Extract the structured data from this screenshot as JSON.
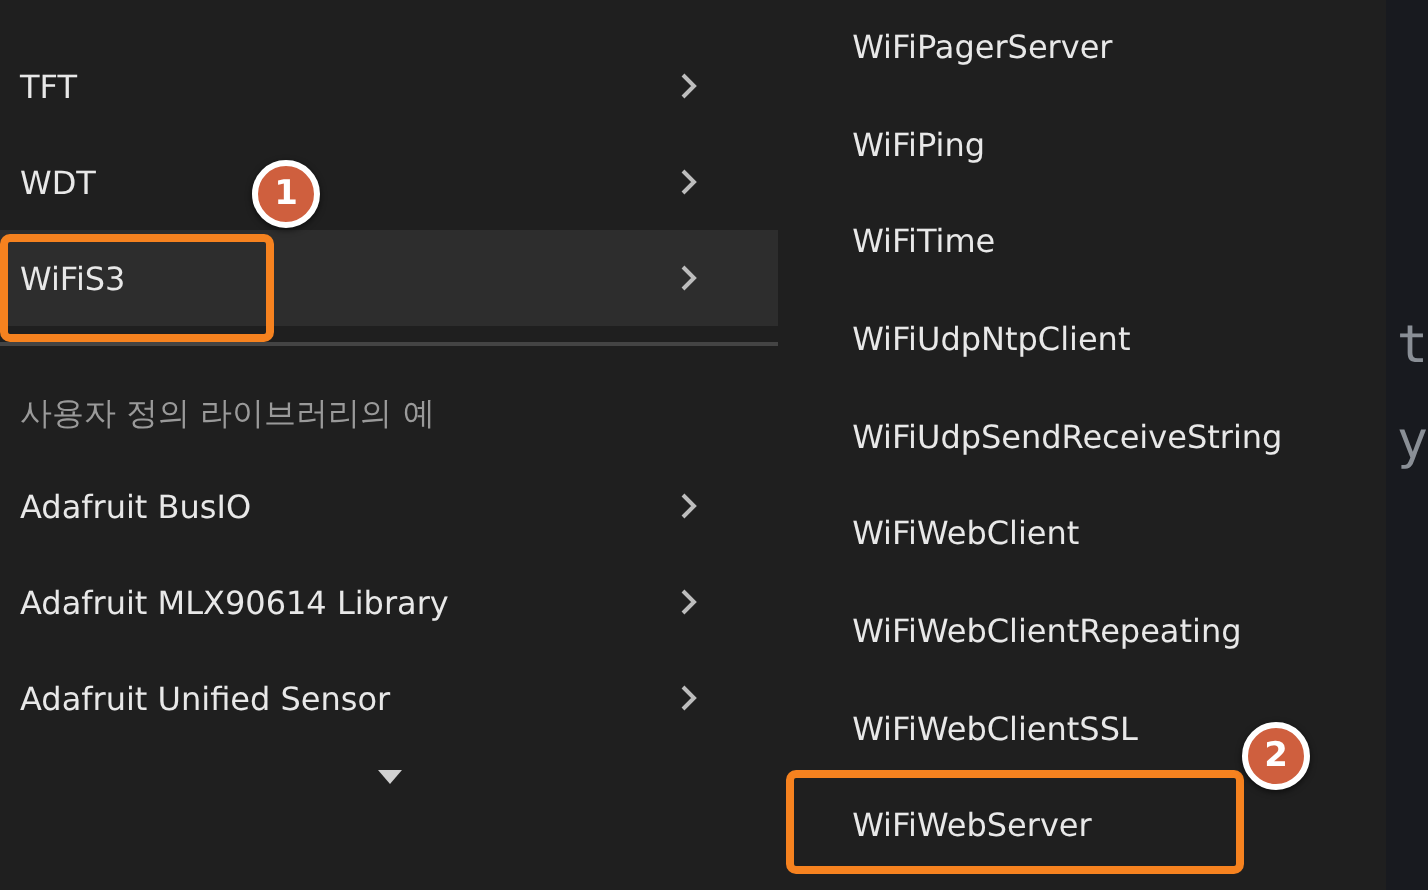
{
  "menu": {
    "items": [
      {
        "label": "TFT",
        "selected": false
      },
      {
        "label": "WDT",
        "selected": false
      },
      {
        "label": "WiFiS3",
        "selected": true
      }
    ],
    "section_header": "사용자 정의 라이브러리의 예",
    "section_items": [
      {
        "label": "Adafruit BusIO",
        "selected": false
      },
      {
        "label": "Adafruit MLX90614 Library",
        "selected": false
      },
      {
        "label": "Adafruit Unified Sensor",
        "selected": false
      }
    ]
  },
  "submenu": {
    "items": [
      {
        "label": "WiFiPagerServer",
        "selected": false
      },
      {
        "label": "WiFiPing",
        "selected": false
      },
      {
        "label": "WiFiTime",
        "selected": false
      },
      {
        "label": "WiFiUdpNtpClient",
        "selected": false
      },
      {
        "label": "WiFiUdpSendReceiveString",
        "selected": false
      },
      {
        "label": "WiFiWebClient",
        "selected": false
      },
      {
        "label": "WiFiWebClientRepeating",
        "selected": false
      },
      {
        "label": "WiFiWebClientSSL",
        "selected": false
      },
      {
        "label": "WiFiWebServer",
        "selected": false
      }
    ]
  },
  "editor_fragments": [
    "t",
    "y"
  ],
  "annotations": [
    {
      "label": "1"
    },
    {
      "label": "2"
    }
  ]
}
